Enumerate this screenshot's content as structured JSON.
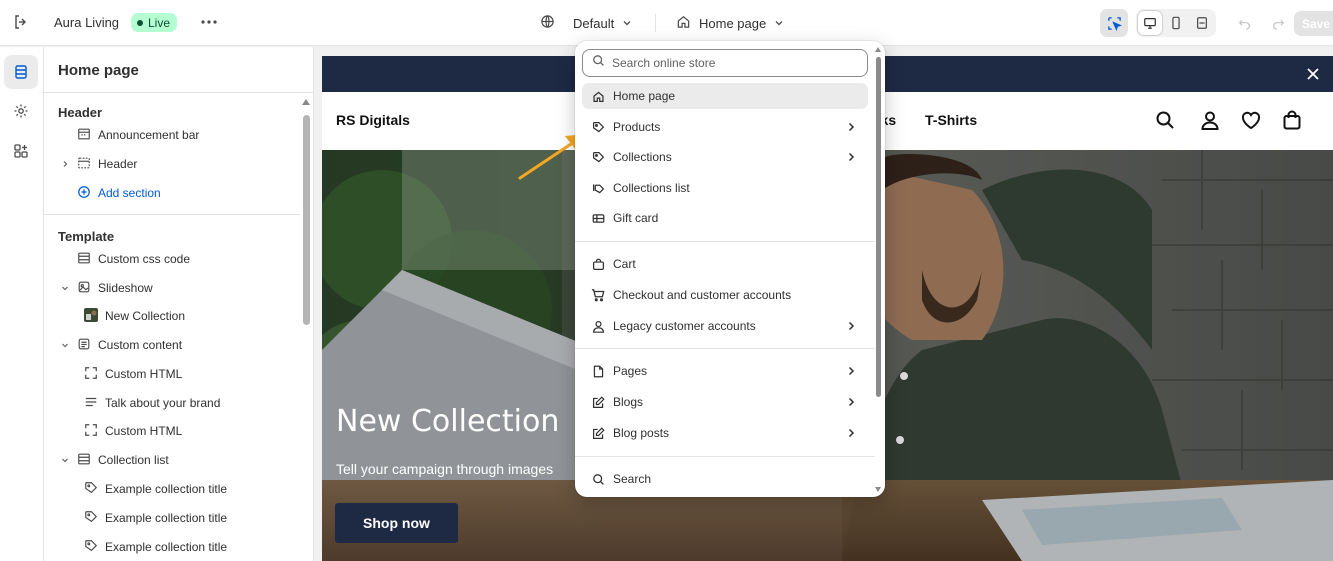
{
  "topbar": {
    "store_name": "Aura Living",
    "live_label": "Live",
    "theme": "Default",
    "page": "Home page",
    "save_label": "Save"
  },
  "sidebar": {
    "title": "Home page",
    "header_group": "Header",
    "header_items": [
      {
        "label": "Announcement bar"
      },
      {
        "label": "Header"
      },
      {
        "label": "Add section"
      }
    ],
    "template_group": "Template",
    "template_items": [
      {
        "label": "Custom css code"
      },
      {
        "label": "Slideshow"
      },
      {
        "label": "New Collection"
      },
      {
        "label": "Custom content"
      },
      {
        "label": "Custom HTML"
      },
      {
        "label": "Talk about your brand"
      },
      {
        "label": "Custom HTML"
      },
      {
        "label": "Collection list"
      },
      {
        "label": "Example collection title"
      },
      {
        "label": "Example collection title"
      },
      {
        "label": "Example collection title"
      }
    ]
  },
  "preview": {
    "brand": "RS Digitals",
    "nav_fragment": "nks",
    "nav_tshirts": "T-Shirts",
    "hero_title": "New Collection",
    "hero_subtitle": "Tell your campaign through images",
    "hero_button": "Shop now"
  },
  "dropdown": {
    "search_placeholder": "Search online store",
    "items": [
      {
        "label": "Home page"
      },
      {
        "label": "Products"
      },
      {
        "label": "Collections"
      },
      {
        "label": "Collections list"
      },
      {
        "label": "Gift card"
      },
      {
        "label": "Cart"
      },
      {
        "label": "Checkout and customer accounts"
      },
      {
        "label": "Legacy customer accounts"
      },
      {
        "label": "Pages"
      },
      {
        "label": "Blogs"
      },
      {
        "label": "Blog posts"
      },
      {
        "label": "Search"
      }
    ]
  },
  "colors": {
    "accent_link": "#005bd3",
    "live_badge_bg": "#b4fed2",
    "live_badge_text": "#0c5132",
    "store_navy": "#1e2a44",
    "annotation_arrow": "#f5a623"
  }
}
